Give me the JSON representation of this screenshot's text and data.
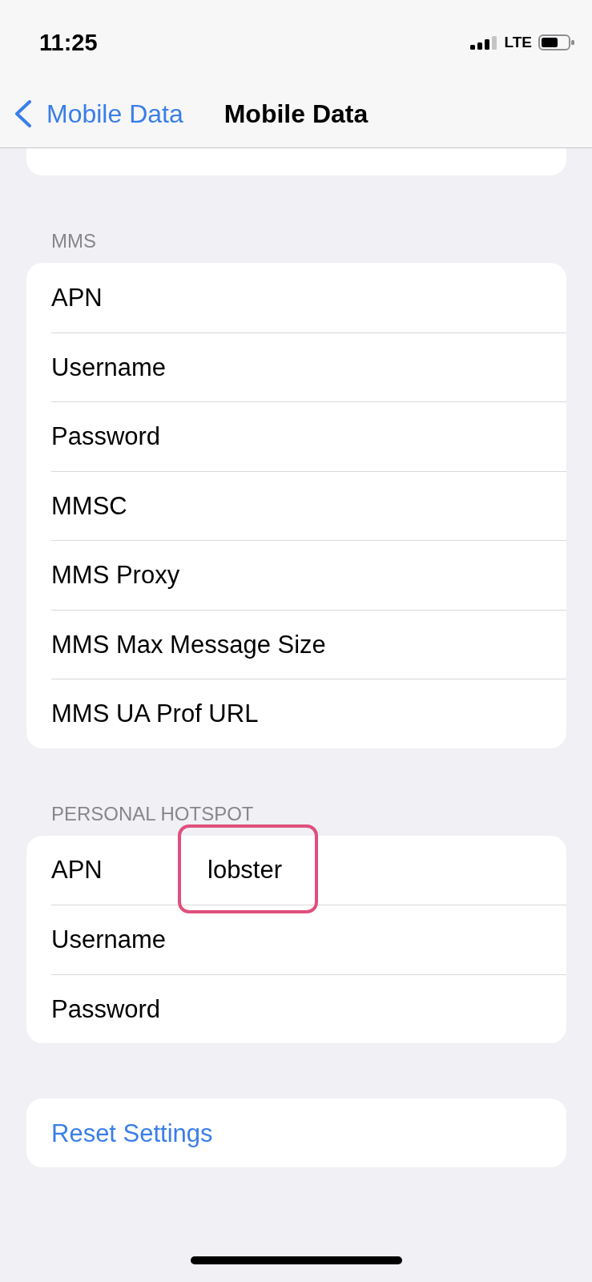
{
  "status_bar": {
    "time": "11:25",
    "network": "LTE"
  },
  "nav_bar": {
    "back_label": "Mobile Data",
    "title": "Mobile Data"
  },
  "sections": [
    {
      "header": "MMS",
      "rows": [
        {
          "kind": "field",
          "label": "APN",
          "highlighted": false
        },
        {
          "kind": "field",
          "label": "Username",
          "highlighted": false
        },
        {
          "kind": "field",
          "label": "Password",
          "highlighted": false
        },
        {
          "kind": "field",
          "label": "MMSC",
          "highlighted": false
        },
        {
          "kind": "field",
          "label": "MMS Proxy",
          "highlighted": false
        },
        {
          "kind": "field",
          "label": "MMS Max Message Size",
          "highlighted": false
        },
        {
          "kind": "field",
          "label": "MMS UA Prof URL",
          "highlighted": false
        }
      ]
    },
    {
      "header": "PERSONAL HOTSPOT",
      "rows": [
        {
          "kind": "field",
          "label": "APN",
          "value": "lobster",
          "highlighted": true
        },
        {
          "kind": "field",
          "label": "Username",
          "highlighted": false
        },
        {
          "kind": "field",
          "label": "Password",
          "highlighted": false
        }
      ]
    },
    {
      "rows": [
        {
          "kind": "action",
          "label": "Reset Settings",
          "highlighted": false
        }
      ]
    }
  ]
}
